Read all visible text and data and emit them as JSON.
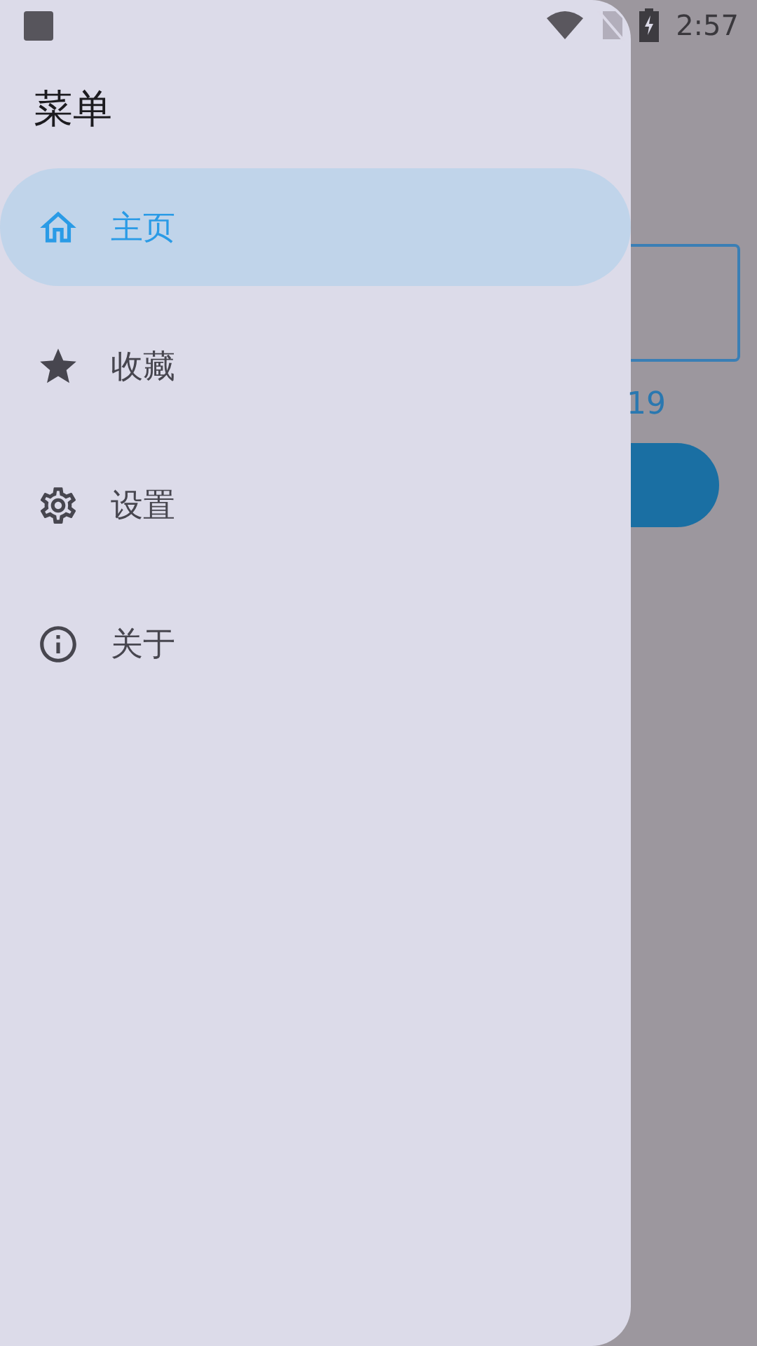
{
  "status_bar": {
    "time": "2:57"
  },
  "drawer": {
    "title": "菜单",
    "items": [
      {
        "kind": "home",
        "label": "主页",
        "selected": true
      },
      {
        "kind": "star",
        "label": "收藏",
        "selected": false
      },
      {
        "kind": "gear",
        "label": "设置",
        "selected": false
      },
      {
        "kind": "info",
        "label": "关于",
        "selected": false
      }
    ]
  },
  "background": {
    "partial_text": "19"
  }
}
